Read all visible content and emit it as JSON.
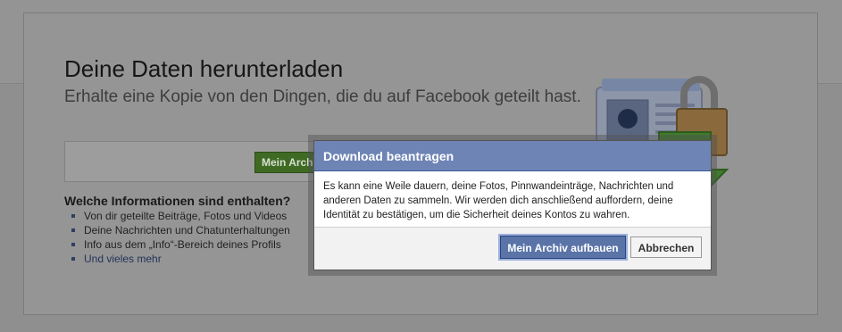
{
  "page": {
    "title": "Deine Daten herunterladen",
    "subtitle": "Erhalte eine Kopie von den Dingen, die du auf Facebook geteilt hast.",
    "archive_button_label": "Mein Archi",
    "info_heading": "Welche Informationen sind enthalten?",
    "info_items": [
      "Von dir geteilte Beiträge, Fotos und Videos",
      "Deine Nachrichten und Chatunterhaltungen",
      "Info aus dem „Info“-Bereich deines Profils",
      "Und vieles mehr"
    ]
  },
  "illustration": {
    "icons": [
      "profile-card-icon",
      "padlock-icon",
      "download-arrow-icon"
    ]
  },
  "dialog": {
    "title": "Download beantragen",
    "body": "Es kann eine Weile dauern, deine Fotos, Pinnwandeinträge, Nachrichten und anderen Daten zu sammeln. Wir werden dich anschließend auffordern, deine Identität zu bestätigen, um die Sicherheit deines Kontos zu wahren.",
    "confirm_label": "Mein Archiv aufbauen",
    "cancel_label": "Abbrechen"
  },
  "colors": {
    "dialog_header": "#6d84b4",
    "primary_button": "#5b74a8",
    "background_archive_button": "#3f6a23",
    "overlay": "#8f8f8f"
  }
}
